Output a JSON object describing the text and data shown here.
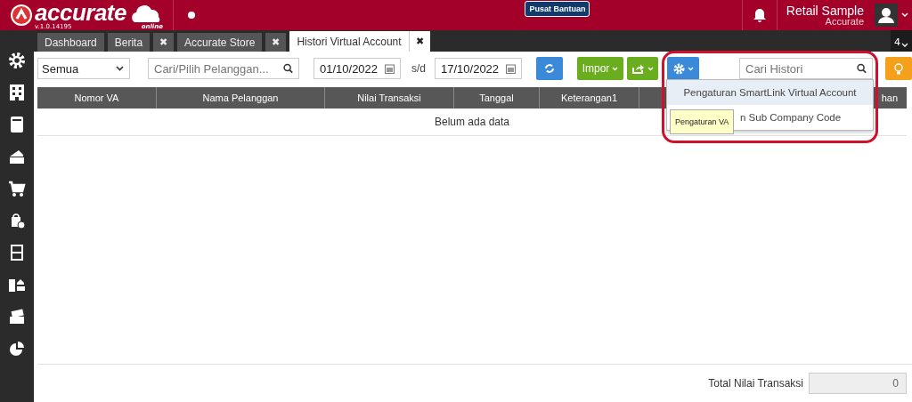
{
  "header": {
    "logo": "accurate",
    "logo_sub": "online",
    "version": "v.1.0.14195",
    "help_button": "Pusat Bantuan",
    "company": "Retail Sample",
    "user": "Accurate"
  },
  "tabs": [
    {
      "label": "Dashboard",
      "selected": false
    },
    {
      "label": "Berita",
      "close": "✖",
      "selected": false
    },
    {
      "label": "Accurate Store",
      "close": "✖",
      "selected": false
    },
    {
      "label": "Histori Virtual Account",
      "close": "✖",
      "selected": true
    }
  ],
  "tab_count": "4",
  "sidebar": {
    "items": [
      {
        "kind": "gear"
      },
      {
        "kind": "building"
      },
      {
        "kind": "book"
      },
      {
        "kind": "card"
      },
      {
        "kind": "cart"
      },
      {
        "kind": "bag"
      },
      {
        "kind": "cabinet"
      },
      {
        "kind": "assets"
      },
      {
        "kind": "tax"
      },
      {
        "kind": "pie"
      }
    ]
  },
  "toolbar": {
    "filter": "Semua",
    "customer_search": {
      "placeholder": "Cari/Pilih Pelanggan..."
    },
    "date_from": "01/10/2022",
    "range_sep": "s/d",
    "date_to": "17/10/2022",
    "import_button": "Impor",
    "history_search": {
      "placeholder": "Cari Histori"
    }
  },
  "table": {
    "columns": [
      "Nomor VA",
      "Nama Pelanggan",
      "Nilai Transaksi",
      "Tanggal",
      "Keterangan1",
      "",
      "han"
    ],
    "empty_text": "Belum ada data"
  },
  "settings_menu": {
    "items": [
      {
        "label": "Pengaturan SmartLink Virtual Account",
        "selected": true
      },
      {
        "label": "n Sub Company Code",
        "selected": false
      }
    ],
    "tooltip": "Pengaturan VA"
  },
  "footer": {
    "total_label": "Total Nilai Transaksi",
    "total_value": "0"
  }
}
